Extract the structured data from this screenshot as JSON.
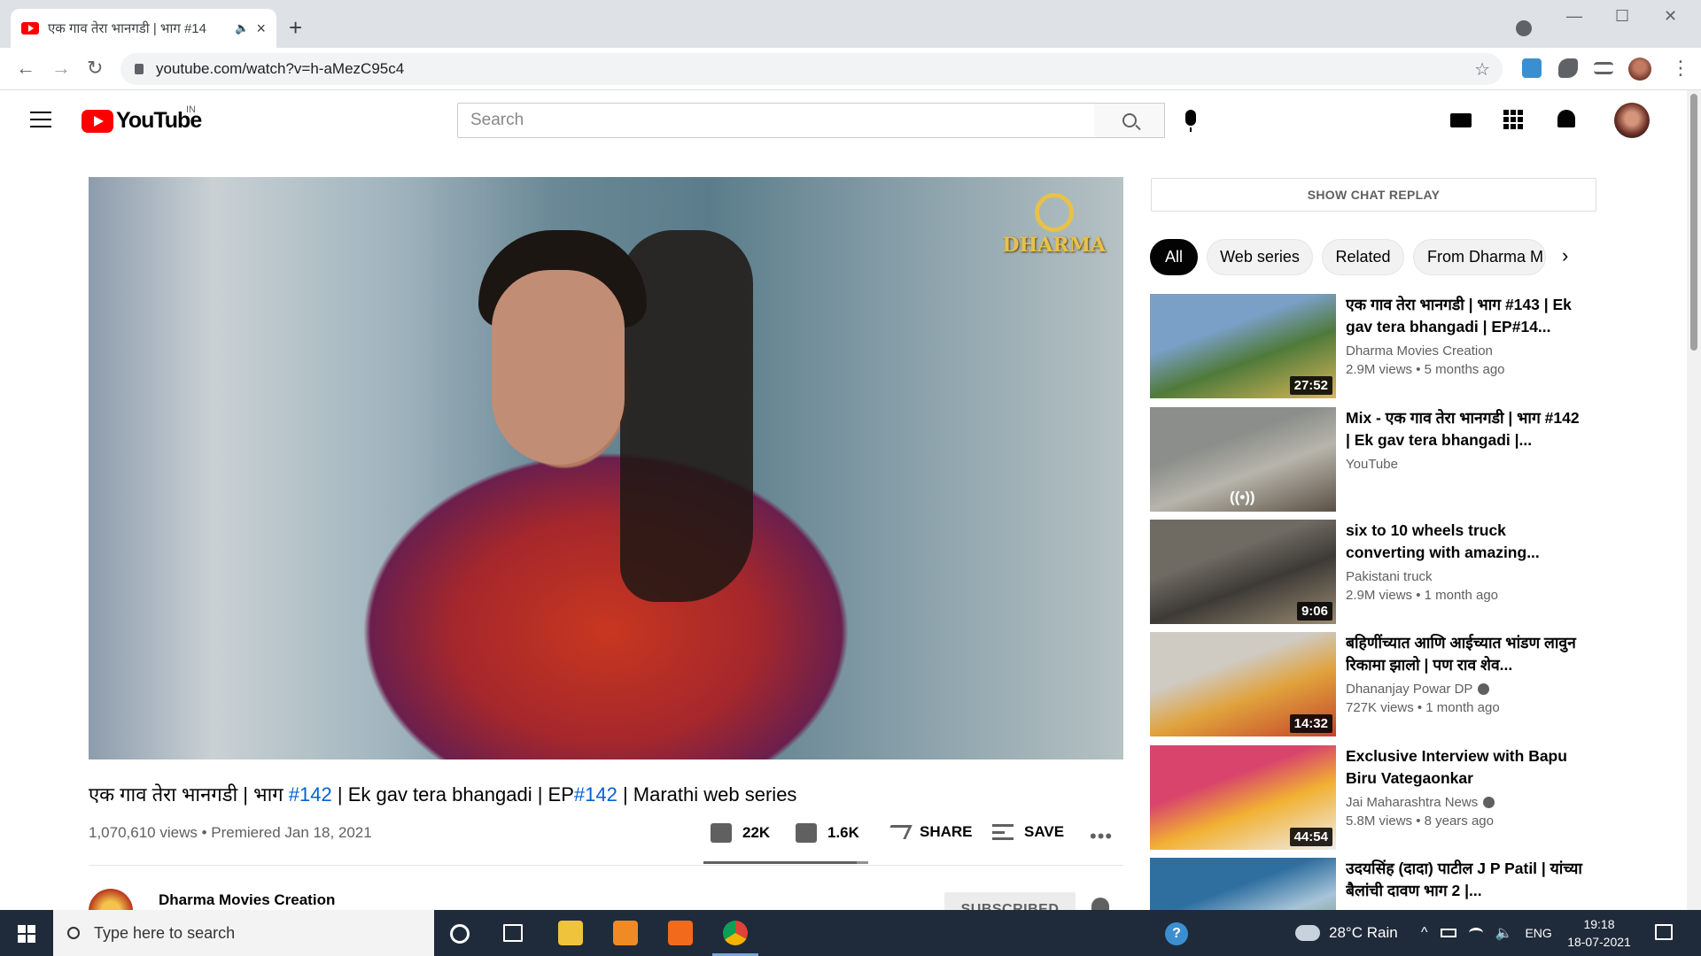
{
  "browser": {
    "tab_title": "एक गाव तेरा भानगडी | भाग #14",
    "tab_audio": "🔈",
    "tab_close": "×",
    "new_tab": "+",
    "url": "youtube.com/watch?v=h-aMezC95c4",
    "back": "←",
    "forward": "→",
    "reload": "↻",
    "star": "☆",
    "menu": "⋮",
    "minimize": "—",
    "maximize": "☐",
    "close": "✕"
  },
  "youtube": {
    "logo_text": "YouTube",
    "region": "IN",
    "search_placeholder": "Search"
  },
  "video": {
    "title_part1": "एक गाव तेरा भानगडी | भाग ",
    "title_tag1": "#142",
    "title_part2": " | Ek gav tera bhangadi | EP",
    "title_tag2": "#142",
    "title_part3": " | Marathi web series",
    "meta": "1,070,610 views • Premiered Jan 18, 2021",
    "likes": "22K",
    "dislikes": "1.6K",
    "share_label": "SHARE",
    "save_label": "SAVE",
    "more": "•••",
    "like_ratio": 0.93,
    "watermark": "DHARMA",
    "channel_name": "Dharma Movies Creation",
    "subscribed_label": "SUBSCRIBED"
  },
  "sidebar": {
    "chat_replay": "SHOW CHAT REPLAY",
    "chips": [
      "All",
      "Web series",
      "Related",
      "From Dharma M"
    ],
    "chip_arrow": "›",
    "recommendations": [
      {
        "title": "एक गाव तेरा भानगडी | भाग #143 | Ek gav tera bhangadi | EP#14...",
        "channel": "Dharma Movies Creation",
        "meta": "2.9M views • 5 months ago",
        "duration": "27:52",
        "verified": false,
        "colors": [
          "#7aa0c8",
          "#4f7a3a",
          "#d9b65a"
        ]
      },
      {
        "title": "Mix - एक गाव तेरा भानगडी | भाग #142 | Ek gav tera bhangadi |...",
        "channel": "YouTube",
        "meta": "",
        "duration": "",
        "mix_icon": "((•))",
        "verified": false,
        "colors": [
          "#8b8e8a",
          "#b7b5ab",
          "#5b4f44"
        ]
      },
      {
        "title": "six to 10 wheels truck converting with amazing...",
        "channel": "Pakistani truck",
        "meta": "2.9M views • 1 month ago",
        "duration": "9:06",
        "verified": false,
        "colors": [
          "#6f6a62",
          "#3d3a36",
          "#9a8a72"
        ]
      },
      {
        "title": "बहिणींच्यात आणि आईच्यात भांडण लावुन रिकामा झालो | पण राव शेव...",
        "channel": "Dhananjay Powar DP",
        "meta": "727K views • 1 month ago",
        "duration": "14:32",
        "verified": true,
        "colors": [
          "#cfcac2",
          "#e0a23c",
          "#c4442a"
        ]
      },
      {
        "title": "Exclusive Interview with Bapu Biru Vategaonkar",
        "channel": "Jai Maharashtra News",
        "meta": "5.8M views • 8 years ago",
        "duration": "44:54",
        "verified": true,
        "colors": [
          "#d8446c",
          "#f1b133",
          "#eeeeee"
        ]
      },
      {
        "title": "उदयसिंह (दादा) पाटील J P Patil | यांच्या बैलांची दावण भाग 2 |...",
        "channel": "",
        "meta": "",
        "duration": "",
        "verified": false,
        "colors": [
          "#2f6fa0",
          "#a7c4d8",
          "#5a7a3a"
        ]
      }
    ]
  },
  "taskbar": {
    "search_placeholder": "Type here to search",
    "weather": "28°C  Rain",
    "lang": "ENG",
    "time": "19:18",
    "date": "18-07-2021",
    "help": "?"
  }
}
